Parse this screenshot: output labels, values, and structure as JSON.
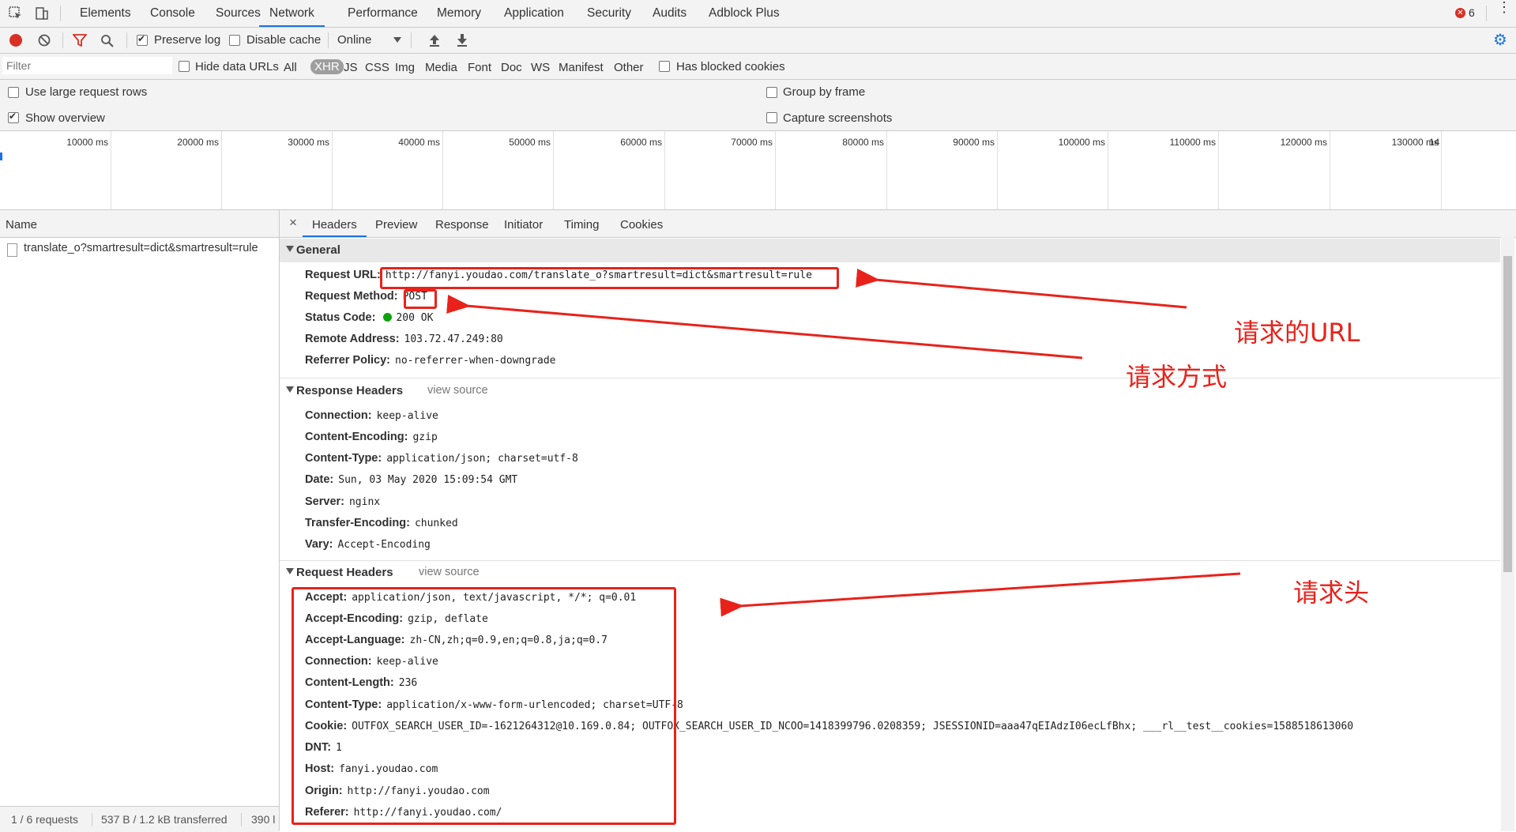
{
  "tabbar": {
    "tabs": [
      "Elements",
      "Console",
      "Sources",
      "Network",
      "Performance",
      "Memory",
      "Application",
      "Security",
      "Audits",
      "Adblock Plus"
    ],
    "active_tab": "Network",
    "error_count": "6"
  },
  "toolbar": {
    "preserve_log": "Preserve log",
    "disable_cache": "Disable cache",
    "throttle": "Online"
  },
  "filterbar": {
    "placeholder": "Filter",
    "hide_data_urls": "Hide data URLs",
    "types": [
      "All",
      "XHR",
      "JS",
      "CSS",
      "Img",
      "Media",
      "Font",
      "Doc",
      "WS",
      "Manifest",
      "Other"
    ],
    "active_type": "XHR",
    "blocked_cookies": "Has blocked cookies"
  },
  "options": {
    "large_rows": "Use large request rows",
    "show_overview": "Show overview",
    "group_by_frame": "Group by frame",
    "capture_screenshots": "Capture screenshots"
  },
  "overview": {
    "ticks": [
      "10000 ms",
      "20000 ms",
      "30000 ms",
      "40000 ms",
      "50000 ms",
      "60000 ms",
      "70000 ms",
      "80000 ms",
      "90000 ms",
      "100000 ms",
      "110000 ms",
      "120000 ms",
      "130000 ms",
      "14"
    ]
  },
  "left": {
    "name_header": "Name",
    "request_name": "translate_o?smartresult=dict&smartresult=rule",
    "status": {
      "requests": "1 / 6 requests",
      "transferred": "537 B / 1.2 kB transferred",
      "extra": "390 l"
    }
  },
  "details": {
    "close": "×",
    "tabs": [
      "Headers",
      "Preview",
      "Response",
      "Initiator",
      "Timing",
      "Cookies"
    ],
    "active_tab": "Headers",
    "general": {
      "title": "General",
      "rows": [
        {
          "k": "Request URL:",
          "v": "http://fanyi.youdao.com/translate_o?smartresult=dict&smartresult=rule"
        },
        {
          "k": "Request Method:",
          "v": "POST"
        },
        {
          "k": "Status Code:",
          "v": "200 OK"
        },
        {
          "k": "Remote Address:",
          "v": "103.72.47.249:80"
        },
        {
          "k": "Referrer Policy:",
          "v": "no-referrer-when-downgrade"
        }
      ]
    },
    "response_headers": {
      "title": "Response Headers",
      "view_source": "view source",
      "rows": [
        {
          "k": "Connection:",
          "v": "keep-alive"
        },
        {
          "k": "Content-Encoding:",
          "v": "gzip"
        },
        {
          "k": "Content-Type:",
          "v": "application/json; charset=utf-8"
        },
        {
          "k": "Date:",
          "v": "Sun, 03 May 2020 15:09:54 GMT"
        },
        {
          "k": "Server:",
          "v": "nginx"
        },
        {
          "k": "Transfer-Encoding:",
          "v": "chunked"
        },
        {
          "k": "Vary:",
          "v": "Accept-Encoding"
        }
      ]
    },
    "request_headers": {
      "title": "Request Headers",
      "view_source": "view source",
      "rows": [
        {
          "k": "Accept:",
          "v": "application/json, text/javascript, */*; q=0.01"
        },
        {
          "k": "Accept-Encoding:",
          "v": "gzip, deflate"
        },
        {
          "k": "Accept-Language:",
          "v": "zh-CN,zh;q=0.9,en;q=0.8,ja;q=0.7"
        },
        {
          "k": "Connection:",
          "v": "keep-alive"
        },
        {
          "k": "Content-Length:",
          "v": "236"
        },
        {
          "k": "Content-Type:",
          "v": "application/x-www-form-urlencoded; charset=UTF-8"
        },
        {
          "k": "Cookie:",
          "v": "OUTFOX_SEARCH_USER_ID=-1621264312@10.169.0.84; OUTFOX_SEARCH_USER_ID_NCOO=1418399796.0208359; JSESSIONID=aaa47qEIAdzI06ecLfBhx; ___rl__test__cookies=1588518613060"
        },
        {
          "k": "DNT:",
          "v": "1"
        },
        {
          "k": "Host:",
          "v": "fanyi.youdao.com"
        },
        {
          "k": "Origin:",
          "v": "http://fanyi.youdao.com"
        },
        {
          "k": "Referer:",
          "v": "http://fanyi.youdao.com/"
        }
      ]
    }
  },
  "annotations": {
    "url_label": "请求的URL",
    "method_label": "请求方式",
    "headers_label": "请求头"
  },
  "colors": {
    "accent": "#1a73e8",
    "annotation": "#e8221b",
    "record": "#d93025",
    "status_ok": "#0ca30c"
  }
}
